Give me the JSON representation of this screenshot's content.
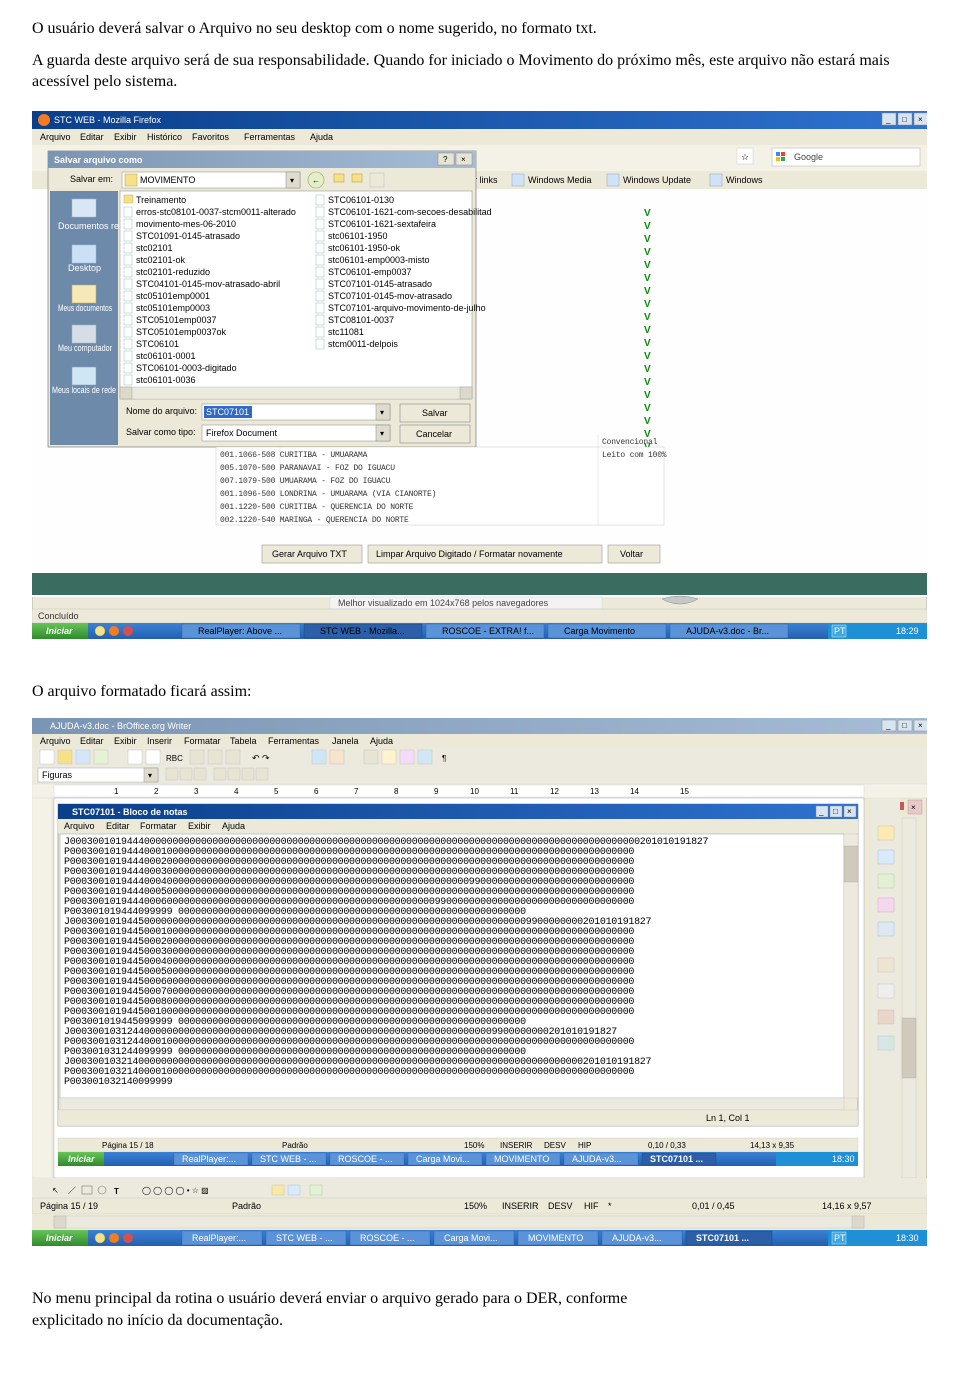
{
  "document": {
    "para1": "O usuário deverá salvar o Arquivo no seu desktop com o nome sugerido, no formato txt.",
    "para2": "A guarda deste arquivo será de sua responsabilidade. Quando for iniciado o Movimento do próximo mês, este arquivo não estará mais acessível pelo sistema.",
    "mid_caption": "O arquivo formatado ficará assim:",
    "para3_a": "No menu principal da rotina o usuário deverá enviar o arquivo gerado para o DER, conforme",
    "para3_b": "explicitado no início da documentação."
  },
  "screenshot1": {
    "firefox_title": "STC WEB - Mozilla Firefox",
    "firefox_menu": [
      "Arquivo",
      "Editar",
      "Exibir",
      "Histórico",
      "Favoritos",
      "Ferramentas",
      "Ajuda"
    ],
    "save_dialog": {
      "title": "Salvar arquivo como",
      "salvar_em_label": "Salvar em:",
      "salvar_em_value": "MOVIMENTO",
      "places": [
        "Documentos recentes",
        "Desktop",
        "Meus documentos",
        "Meu computador",
        "Meus locais de rede"
      ],
      "files_col1": [
        "Treinamento",
        "erros-stc08101-0037-stcm0011-alterado",
        "movimento-mes-06-2010",
        "STC01091-0145-atrasado",
        "stc02101",
        "stc02101-ok",
        "stc02101-reduzido",
        "STC04101-0145-mov-atrasado-abril",
        "stc05101emp0001",
        "stc05101emp0003",
        "STC05101emp0037",
        "STC05101emp0037ok",
        "STC06101",
        "stc06101-0001",
        "STC06101-0003-digitado",
        "stc06101-0036"
      ],
      "files_col2": [
        "STC06101-0130",
        "STC06101-1621-com-secoes-desabilitad",
        "STC06101-1621-sextafeira",
        "stc06101-1950",
        "stc06101-1950-ok",
        "stc06101-emp0003-misto",
        "STC06101-emp0037",
        "STC07101-0145-atrasado",
        "STC07101-0145-mov-atrasado",
        "STC07101-arquivo-movimento-de-julho",
        "STC08101-0037",
        "stc11081",
        "stcm0011-delpois"
      ],
      "nome_label": "Nome do arquivo:",
      "nome_value": "STC07101",
      "tipo_label": "Salvar como tipo:",
      "tipo_value": "Firefox Document",
      "btn_salvar": "Salvar",
      "btn_cancelar": "Cancelar"
    },
    "toolbar_links": [
      "Windows Media",
      "Windows Update",
      "Windows"
    ],
    "toolbar_search_placeholder": "Google",
    "toolbar_links_label": "r links",
    "table_rows": [
      "001.1066-508 CURITIBA - UMUARAMA",
      "005.1070-500 PARANAVAI - FOZ DO IGUACU",
      "007.1079-500 UMUARAMA - FOZ DO IGUACU",
      "001.1096-500 LONDRINA - UMUARAMA (VIA CIANORTE)",
      "001.1220-500 CURITIBA - QUERENCIA DO NORTE",
      "002.1220-540 MARINGA - QUERENCIA DO NORTE"
    ],
    "table_mid_labels": [
      "Convencional",
      "Leito com 100%"
    ],
    "buttons_row": [
      "Gerar Arquivo TXT",
      "Limpar Arquivo Digitado / Formatar novamente",
      "Voltar"
    ],
    "footer_text": "Melhor visualizado em 1024x768 pelos navegadores",
    "status_left": "Concluído",
    "taskbar": [
      "Iniciar",
      "RealPlayer: Above ...",
      "STC WEB - Mozilla...",
      "ROSCOE - EXTRA! f...",
      "Carga Movimento",
      "AJUDA-v3.doc - Br..."
    ],
    "clock": "18:29",
    "lang": "PT"
  },
  "screenshot2": {
    "writer_title": "AJUDA-v3.doc - BrOffice.org Writer",
    "writer_menu": [
      "Arquivo",
      "Editar",
      "Exibir",
      "Inserir",
      "Formatar",
      "Tabela",
      "Ferramentas",
      "Janela",
      "Ajuda"
    ],
    "style_combo": "Figuras",
    "notepad_title": "STC07101 - Bloco de notas",
    "notepad_menu": [
      "Arquivo",
      "Editar",
      "Formatar",
      "Exibir",
      "Ajuda"
    ],
    "notepad_lines": [
      "J0003001019444000000000000000000000000000000000000000000000000000000000000000000000000000000000000000201010191827",
      "P000300101944400010000000000000000000000000000000000000000000000000000000000000000000000000000000000",
      "P000300101944400020000000000000000000000000000000000000000000000000000000000000000000000000000000000",
      "P000300101944400030000000000000000000000000000000000000000000000000000000000000000000000000000000000",
      "P000300101944400040000000000000000000000000000000000000000000000000000099000000000000000000000000000",
      "P000300101944400050000000000000000000000000000000000000000000000000000000000000000000000000000000000",
      "P000300101944400060000000000000000000000000000000000000000000000099000000000000000000000000000000000",
      "P003001019444099999                    0000000000000000000000000000000000000000000000000000000000000",
      "J000300101944500000000000000000000000000000000000000000000000000000000000000000009900000000201010191827",
      "P000300101944500010000000000000000000000000000000000000000000000000000000000000000000000000000000000",
      "P000300101944500020000000000000000000000000000000000000000000000000000000000000000000000000000000000",
      "P000300101944500030000000000000000000000000000000000000000000000000000000000000000000000000000000000",
      "P000300101944500040000000000000000000000000000000000000000000000000000000000000000000000000000000000",
      "P000300101944500050000000000000000000000000000000000000000000000000000000000000000000000000000000000",
      "P000300101944500060000000000000000000000000000000000000000000000000000000000000000000000000000000000",
      "P000300101944500070000000000000000000000000000000000000000000000000000000000000000000000000000000000",
      "P000300101944500080000000000000000000000000000000000000000000000000000000000000000000000000000000000",
      "P000300101944500100000000000000000000000000000000000000000000000000000000000000000000000000000000000",
      "P003001019445099999                    0000000000000000000000000000000000000000000000000000000000000",
      "J000300103124400000000000000000000000000000000000000000000000000000000000009900000000201010191827",
      "P000300103124400010000000000000000000000000000000000000000000000000000000000000000000000000000000000",
      "P003001031244099999                    0000000000000000000000000000000000000000000000000000000000000",
      "J000300103214000000000000000000000000000000000000000000000000000000000000000000000000000000201010191827",
      "P000300103214000010000000000000000000000000000000000000000000000000000000000000000000000000000000000",
      "P003001032140099999"
    ],
    "notepad_status_right": "Ln 1, Col 1",
    "inner_status": [
      "Página 15 / 18",
      "Padrão",
      "150%",
      "INSERIR",
      "DESV",
      "HIP",
      "0,10 / 0,33",
      "14,13 x 9,35"
    ],
    "outer_status": [
      "Página 15 / 19",
      "Padrão",
      "150%",
      "INSERIR",
      "DESV",
      "HIF",
      "0,01 / 0,45",
      "14,16 x 9,57"
    ],
    "inner_taskbar": [
      "Iniciar",
      "RealPlayer:...",
      "STC WEB - ...",
      "ROSCOE - ...",
      "Carga Movi...",
      "MOVIMENTO",
      "AJUDA-v3...",
      "STC07101 ..."
    ],
    "outer_taskbar": [
      "Iniciar",
      "RealPlayer:...",
      "STC WEB - ...",
      "ROSCOE - ...",
      "Carga Movi...",
      "MOVIMENTO",
      "AJUDA-v3...",
      "STC07101 ..."
    ],
    "inner_clock": "18:30",
    "outer_clock": "18:30",
    "lang": "PT"
  }
}
